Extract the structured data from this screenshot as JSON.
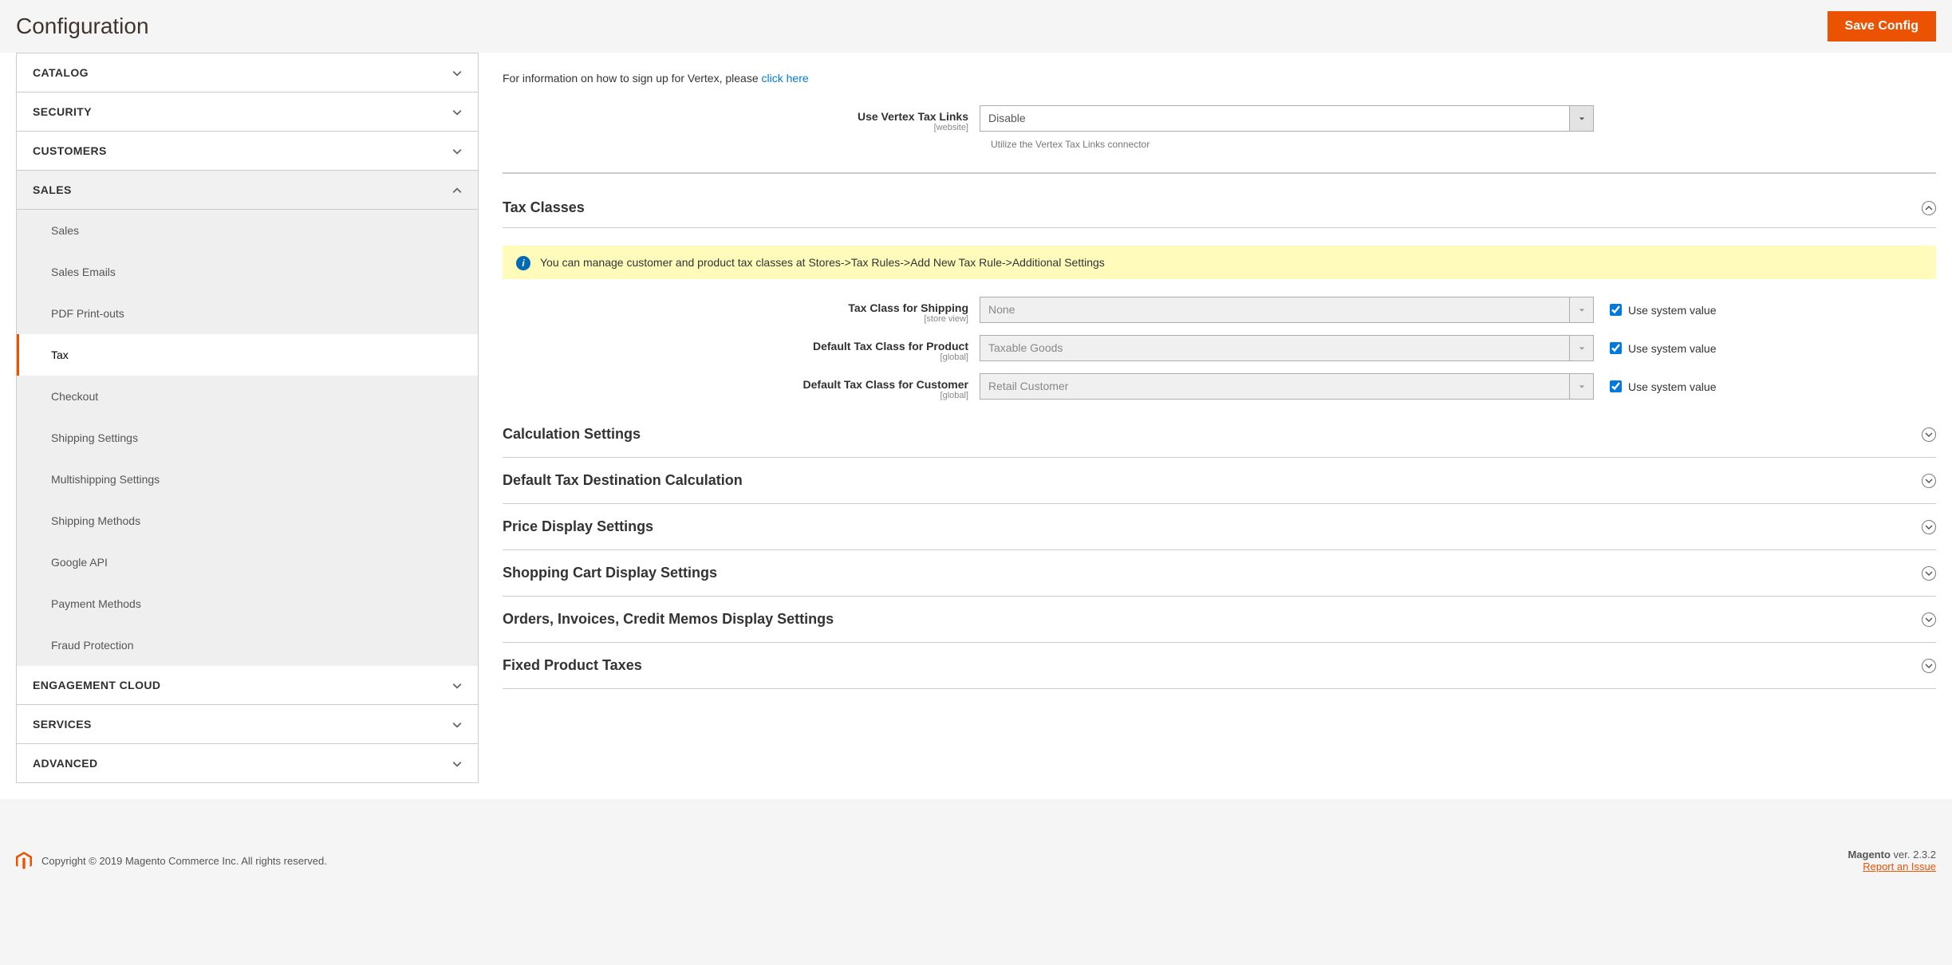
{
  "page_title": "Configuration",
  "save_button": "Save Config",
  "sidebar": {
    "catalog": "CATALOG",
    "security": "SECURITY",
    "customers": "CUSTOMERS",
    "sales": "SALES",
    "engagement": "ENGAGEMENT CLOUD",
    "services": "SERVICES",
    "advanced": "ADVANCED",
    "items": [
      "Sales",
      "Sales Emails",
      "PDF Print-outs",
      "Tax",
      "Checkout",
      "Shipping Settings",
      "Multishipping Settings",
      "Shipping Methods",
      "Google API",
      "Payment Methods",
      "Fraud Protection"
    ]
  },
  "intro": {
    "prefix": "For information on how to sign up for Vertex, please ",
    "link": "click here"
  },
  "vertex": {
    "label": "Use Vertex Tax Links",
    "scope": "[website]",
    "value": "Disable",
    "note": "Utilize the Vertex Tax Links connector"
  },
  "tax_classes": {
    "title": "Tax Classes",
    "notice": "You can manage customer and product tax classes at Stores->Tax Rules->Add New Tax Rule->Additional Settings",
    "shipping": {
      "label": "Tax Class for Shipping",
      "scope": "[store view]",
      "value": "None",
      "use_system": "Use system value"
    },
    "product": {
      "label": "Default Tax Class for Product",
      "scope": "[global]",
      "value": "Taxable Goods",
      "use_system": "Use system value"
    },
    "customer": {
      "label": "Default Tax Class for Customer",
      "scope": "[global]",
      "value": "Retail Customer",
      "use_system": "Use system value"
    }
  },
  "sections": {
    "calc": "Calculation Settings",
    "dest": "Default Tax Destination Calculation",
    "price": "Price Display Settings",
    "cart": "Shopping Cart Display Settings",
    "orders": "Orders, Invoices, Credit Memos Display Settings",
    "fpt": "Fixed Product Taxes"
  },
  "footer": {
    "copyright": "Copyright © 2019 Magento Commerce Inc. All rights reserved.",
    "product_name": "Magento",
    "version": " ver. 2.3.2",
    "report": "Report an Issue"
  }
}
